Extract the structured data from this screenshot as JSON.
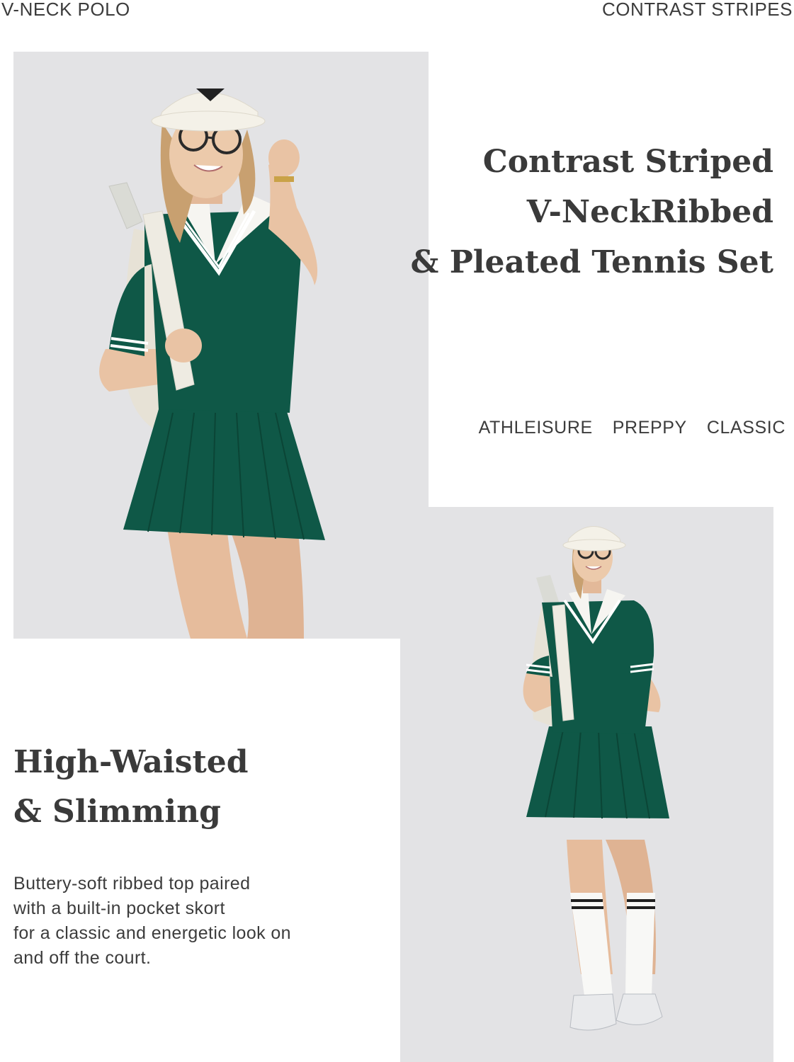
{
  "header": {
    "left_label": "V-NECK POLO",
    "right_label": "CONTRAST STRIPES"
  },
  "headline": {
    "lines": [
      "Contrast Striped",
      "V-NeckRibbed",
      "& Pleated Tennis Set"
    ]
  },
  "tags": [
    "ATHLEISURE",
    "PREPPY",
    "CLASSIC"
  ],
  "feature": {
    "title_lines": [
      "High-Waisted",
      "& Slimming"
    ],
    "description_lines": [
      "Buttery-soft ribbed top paired",
      "with a built-in pocket skort",
      "for a classic and energetic look on",
      "and off the court."
    ]
  },
  "colors": {
    "green": "#0f5847",
    "cream": "#f1efe9",
    "backdrop": "#e3e3e5",
    "skin": "#e9c3a4",
    "hair": "#c8a070"
  }
}
